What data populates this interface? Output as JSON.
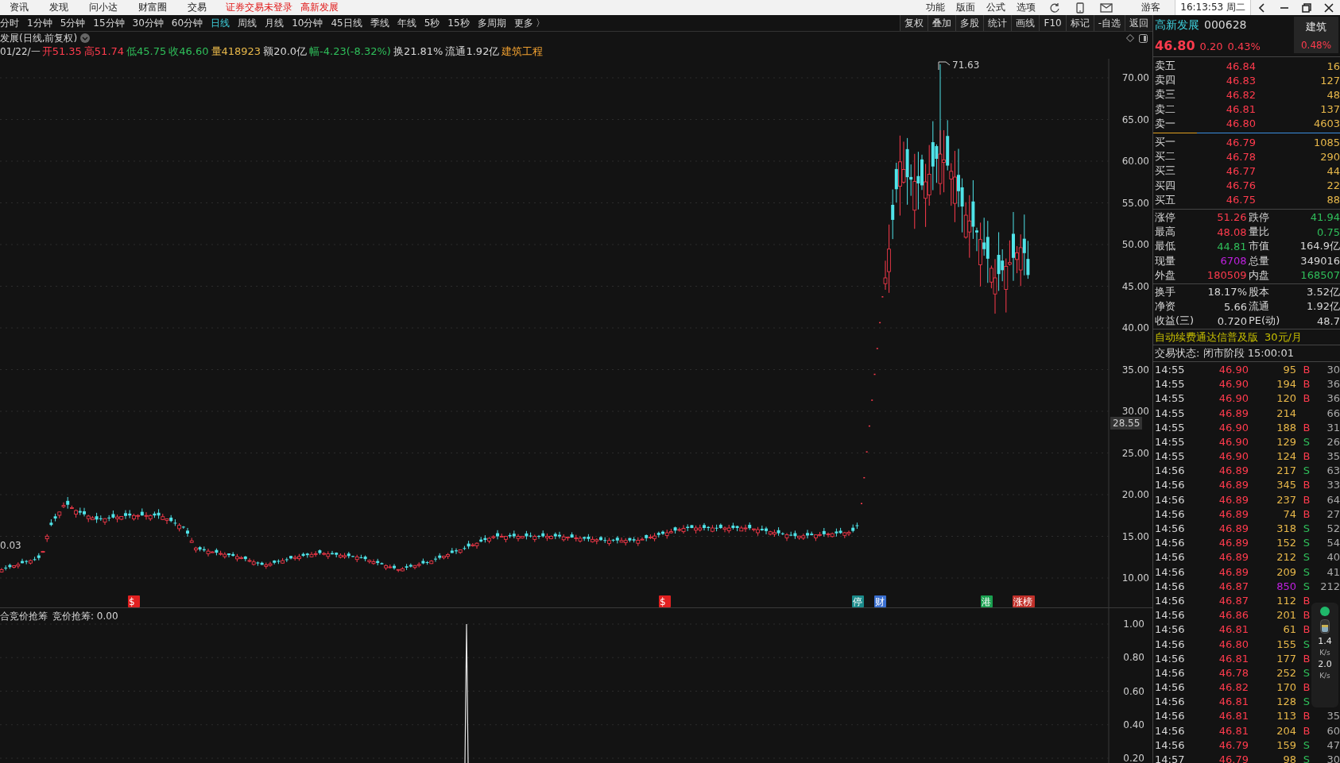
{
  "top_menu": [
    "资讯",
    "发现",
    "问小达",
    "财富圈",
    "交易"
  ],
  "login_notice": "证券交易未登录",
  "stock_link": "高新发展",
  "system_menu": [
    "功能",
    "版面",
    "公式",
    "选项"
  ],
  "user": "游客",
  "clock": "16:13:53 周二",
  "periods": [
    {
      "label": "分时",
      "selected": false
    },
    {
      "label": "1分钟",
      "selected": false
    },
    {
      "label": "5分钟",
      "selected": false
    },
    {
      "label": "15分钟",
      "selected": false
    },
    {
      "label": "30分钟",
      "selected": false
    },
    {
      "label": "60分钟",
      "selected": false
    },
    {
      "label": "日线",
      "selected": true
    },
    {
      "label": "周线",
      "selected": false
    },
    {
      "label": "月线",
      "selected": false
    },
    {
      "label": "10分钟",
      "selected": false
    },
    {
      "label": "45日线",
      "selected": false
    },
    {
      "label": "季线",
      "selected": false
    },
    {
      "label": "年线",
      "selected": false
    },
    {
      "label": "5秒",
      "selected": false
    },
    {
      "label": "15秒",
      "selected": false
    },
    {
      "label": "多周期",
      "selected": false
    },
    {
      "label": "更多 〉",
      "selected": false
    }
  ],
  "toolbar_buttons": [
    "复权",
    "叠加",
    "多股",
    "统计",
    "画线",
    "F10",
    "标记",
    "-自选",
    "返回"
  ],
  "chart": {
    "title": "发展(日线,前复权)",
    "date": "01/22/一",
    "quote": [
      {
        "text": "开51.35",
        "color": "#ff3b4d"
      },
      {
        "text": "高51.74",
        "color": "#ff3b4d"
      },
      {
        "text": "低45.75",
        "color": "#2fbf5a"
      },
      {
        "text": "收46.60",
        "color": "#2fbf5a"
      },
      {
        "text": "量418923",
        "color": "#e8b84a"
      },
      {
        "text": "额20.0亿",
        "color": "#d8d8d8"
      },
      {
        "text": "幅-4.23(-8.32%)",
        "color": "#2fbf5a"
      },
      {
        "text": "换21.81%",
        "color": "#d8d8d8"
      },
      {
        "text": "流通1.92亿",
        "color": "#d8d8d8"
      },
      {
        "text": "建筑工程",
        "color": "#f0a030"
      }
    ],
    "y_ticks": [
      "70.00",
      "65.00",
      "60.00",
      "55.00",
      "50.00",
      "45.00",
      "40.00",
      "35.00",
      "30.00",
      "25.00",
      "20.00",
      "15.00",
      "10.00"
    ],
    "peak_label": "71.63",
    "low_label": "0.03",
    "crosshair_price": "28.55",
    "events": [
      {
        "label": "$",
        "color": "#e02020"
      },
      {
        "label": "$",
        "color": "#e02020"
      },
      {
        "label": "停",
        "color": "#1a8a8a"
      },
      {
        "label": "财",
        "color": "#3a6fd0"
      },
      {
        "label": "港",
        "color": "#1aa050"
      },
      {
        "label": "涨榜",
        "color": "#c0302a"
      }
    ]
  },
  "indicator": {
    "name": "合竞价抢筹",
    "value": "竞价抢筹: 0.00",
    "y_ticks": [
      "1.00",
      "0.80",
      "0.60",
      "0.40",
      "0.20"
    ]
  },
  "quote_panel": {
    "name": "高新发展",
    "code": "000628",
    "price": "46.80",
    "change": "0.20",
    "change_pct": "0.43%",
    "sector": "建筑",
    "sector_pct": "0.48%"
  },
  "asks": [
    {
      "label": "卖五",
      "price": "46.84",
      "volume": "16"
    },
    {
      "label": "卖四",
      "price": "46.83",
      "volume": "127"
    },
    {
      "label": "卖三",
      "price": "46.82",
      "volume": "48"
    },
    {
      "label": "卖二",
      "price": "46.81",
      "volume": "137"
    },
    {
      "label": "卖一",
      "price": "46.80",
      "volume": "4603"
    }
  ],
  "bids": [
    {
      "label": "买一",
      "price": "46.79",
      "volume": "1085"
    },
    {
      "label": "买二",
      "price": "46.78",
      "volume": "290"
    },
    {
      "label": "买三",
      "price": "46.77",
      "volume": "44"
    },
    {
      "label": "买四",
      "price": "46.76",
      "volume": "22"
    },
    {
      "label": "买五",
      "price": "46.75",
      "volume": "88"
    }
  ],
  "stats": [
    {
      "label": "涨停",
      "value": "51.26",
      "color": "#ff3b4d"
    },
    {
      "label": "跌停",
      "value": "41.94",
      "color": "#2fbf5a"
    },
    {
      "label": "最高",
      "value": "48.08",
      "color": "#ff3b4d"
    },
    {
      "label": "量比",
      "value": "0.75",
      "color": "#2fbf5a"
    },
    {
      "label": "最低",
      "value": "44.81",
      "color": "#2fbf5a"
    },
    {
      "label": "市值",
      "value": "164.9亿",
      "color": "#d8d8d8"
    },
    {
      "label": "现量",
      "value": "6708",
      "color": "#c020e0"
    },
    {
      "label": "总量",
      "value": "349016",
      "color": "#d8d8d8"
    },
    {
      "label": "外盘",
      "value": "180509",
      "color": "#ff3b4d"
    },
    {
      "label": "内盘",
      "value": "168507",
      "color": "#2fbf5a"
    }
  ],
  "fundamentals": [
    {
      "label": "换手",
      "value": "18.17%",
      "label2": "股本",
      "value2": "3.52亿"
    },
    {
      "label": "净资",
      "value": "5.66",
      "label2": "流通",
      "value2": "1.92亿"
    },
    {
      "label": "收益(三)",
      "value": "0.720",
      "label2": "PE(动)",
      "value2": "48.7"
    }
  ],
  "ad": {
    "text": "自动续费通达信普及版",
    "price": "30元/月"
  },
  "trade_status": "交易状态: 闭市阶段 15:00:01",
  "trades": [
    {
      "time": "14:55",
      "price": "46.90",
      "volume": "95",
      "side": "B",
      "kind": "buy",
      "count": "30",
      "large": false
    },
    {
      "time": "14:55",
      "price": "46.90",
      "volume": "194",
      "side": "B",
      "kind": "buy",
      "count": "36",
      "large": false
    },
    {
      "time": "14:55",
      "price": "46.90",
      "volume": "120",
      "side": "B",
      "kind": "buy",
      "count": "36",
      "large": false
    },
    {
      "time": "14:55",
      "price": "46.89",
      "volume": "214",
      "kind": "none",
      "count": "66",
      "large": false
    },
    {
      "time": "14:55",
      "price": "46.90",
      "volume": "188",
      "side": "B",
      "kind": "buy",
      "count": "31",
      "large": false
    },
    {
      "time": "14:55",
      "price": "46.90",
      "volume": "129",
      "side": "S",
      "kind": "sell",
      "count": "26",
      "large": false
    },
    {
      "time": "14:55",
      "price": "46.90",
      "volume": "124",
      "side": "B",
      "kind": "buy",
      "count": "35",
      "large": false
    },
    {
      "time": "14:56",
      "price": "46.89",
      "volume": "217",
      "side": "S",
      "kind": "sell",
      "count": "63",
      "large": false
    },
    {
      "time": "14:56",
      "price": "46.89",
      "volume": "345",
      "side": "B",
      "kind": "buy",
      "count": "33",
      "large": false
    },
    {
      "time": "14:56",
      "price": "46.89",
      "volume": "237",
      "side": "B",
      "kind": "buy",
      "count": "64",
      "large": false
    },
    {
      "time": "14:56",
      "price": "46.89",
      "volume": "74",
      "side": "B",
      "kind": "buy",
      "count": "27",
      "large": false
    },
    {
      "time": "14:56",
      "price": "46.89",
      "volume": "318",
      "side": "S",
      "kind": "sell",
      "count": "52",
      "large": false
    },
    {
      "time": "14:56",
      "price": "46.89",
      "volume": "152",
      "side": "S",
      "kind": "sell",
      "count": "54",
      "large": false
    },
    {
      "time": "14:56",
      "price": "46.89",
      "volume": "212",
      "side": "S",
      "kind": "sell",
      "count": "40",
      "large": false
    },
    {
      "time": "14:56",
      "price": "46.89",
      "volume": "209",
      "side": "S",
      "kind": "sell",
      "count": "41",
      "large": false
    },
    {
      "time": "14:56",
      "price": "46.87",
      "volume": "850",
      "side": "S",
      "kind": "sell",
      "count": "212",
      "large": true
    },
    {
      "time": "14:56",
      "price": "46.87",
      "volume": "112",
      "side": "B",
      "kind": "buy",
      "large": false
    },
    {
      "time": "14:56",
      "price": "46.86",
      "volume": "201",
      "side": "B",
      "kind": "buy",
      "large": false
    },
    {
      "time": "14:56",
      "price": "46.81",
      "volume": "61",
      "side": "B",
      "kind": "buy",
      "large": false
    },
    {
      "time": "14:56",
      "price": "46.80",
      "volume": "155",
      "side": "S",
      "kind": "sell",
      "large": false
    },
    {
      "time": "14:56",
      "price": "46.81",
      "volume": "177",
      "side": "B",
      "kind": "buy",
      "large": false
    },
    {
      "time": "14:56",
      "price": "46.78",
      "volume": "252",
      "side": "S",
      "kind": "sell",
      "large": false
    },
    {
      "time": "14:56",
      "price": "46.82",
      "volume": "170",
      "side": "B",
      "kind": "buy",
      "large": false
    },
    {
      "time": "14:56",
      "price": "46.81",
      "volume": "128",
      "side": "S",
      "kind": "sell",
      "large": false
    },
    {
      "time": "14:56",
      "price": "46.81",
      "volume": "113",
      "side": "B",
      "kind": "buy",
      "count": "35",
      "large": false
    },
    {
      "time": "14:56",
      "price": "46.81",
      "volume": "204",
      "side": "B",
      "kind": "buy",
      "count": "60",
      "large": false
    },
    {
      "time": "14:56",
      "price": "46.79",
      "volume": "159",
      "side": "S",
      "kind": "sell",
      "count": "47",
      "large": false
    },
    {
      "time": "14:57",
      "price": "46.79",
      "volume": "98",
      "side": "S",
      "kind": "sell",
      "count": "30",
      "large": false
    }
  ],
  "net_widget": {
    "up": "1.4",
    "up_unit": "K/s",
    "down": "2.0",
    "down_unit": "K/s"
  }
}
